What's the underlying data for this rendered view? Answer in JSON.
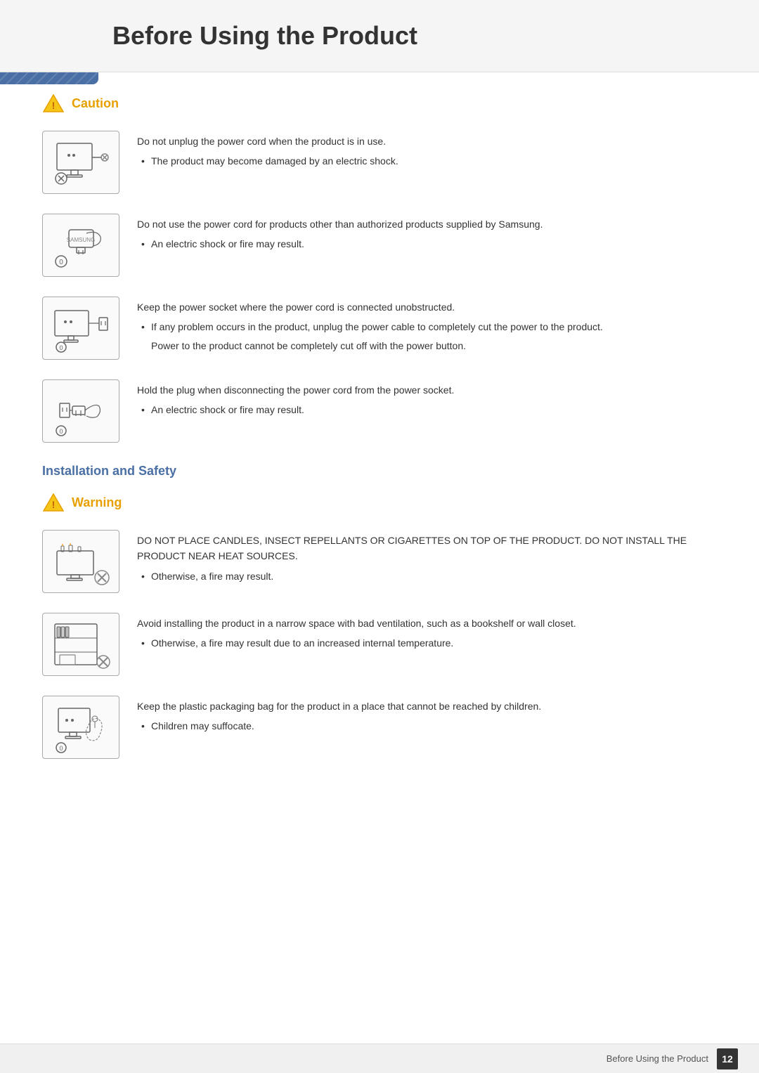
{
  "header": {
    "title": "Before Using the Product"
  },
  "caution_section": {
    "label": "Caution",
    "items": [
      {
        "id": "caution-1",
        "main_text": "Do not unplug the power cord when the product is in use.",
        "bullets": [
          "The product may become damaged by an electric shock."
        ],
        "sub_texts": []
      },
      {
        "id": "caution-2",
        "main_text": "Do not use the power cord for products other than authorized products supplied by Samsung.",
        "bullets": [
          "An electric shock or fire may result."
        ],
        "sub_texts": []
      },
      {
        "id": "caution-3",
        "main_text": "Keep the power socket where the power cord is connected unobstructed.",
        "bullets": [
          "If any problem occurs in the product, unplug the power cable to completely cut the power to the product."
        ],
        "sub_texts": [
          "Power to the product cannot be completely cut off with the power button."
        ]
      },
      {
        "id": "caution-4",
        "main_text": "Hold the plug when disconnecting the power cord from the power socket.",
        "bullets": [
          "An electric shock or fire may result."
        ],
        "sub_texts": []
      }
    ]
  },
  "installation_section": {
    "heading": "Installation and Safety",
    "label": "Warning",
    "items": [
      {
        "id": "warning-1",
        "main_text": "DO NOT PLACE CANDLES, INSECT REPELLANTS OR CIGARETTES ON TOP OF THE PRODUCT. DO NOT INSTALL THE PRODUCT NEAR HEAT SOURCES.",
        "bullets": [
          "Otherwise, a fire may result."
        ],
        "sub_texts": []
      },
      {
        "id": "warning-2",
        "main_text": "Avoid installing the product in a narrow space with bad ventilation, such as a bookshelf or wall closet.",
        "bullets": [
          "Otherwise, a fire may result due to an increased internal temperature."
        ],
        "sub_texts": []
      },
      {
        "id": "warning-3",
        "main_text": "Keep the plastic packaging bag for the product in a place that cannot be reached by children.",
        "bullets": [
          "Children may suffocate."
        ],
        "sub_texts": []
      }
    ]
  },
  "footer": {
    "text": "Before Using the Product",
    "page_number": "12"
  }
}
